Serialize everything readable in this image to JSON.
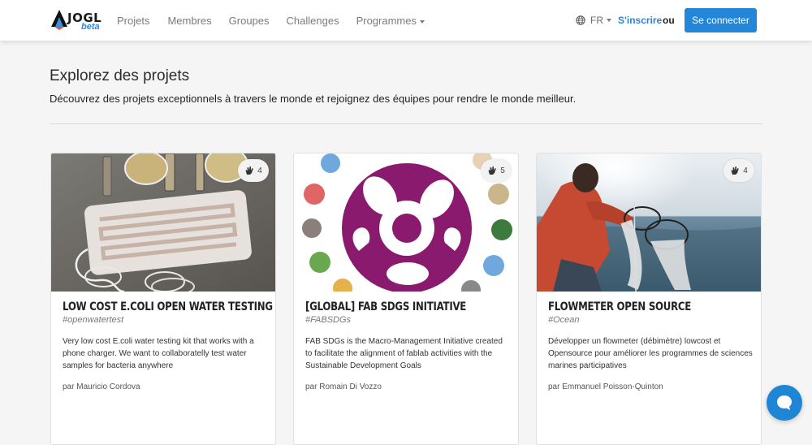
{
  "navbar": {
    "logo_text": "JOGL",
    "logo_beta": "beta",
    "links": [
      "Projets",
      "Membres",
      "Groupes",
      "Challenges",
      "Programmes"
    ],
    "language": "FR",
    "signup": "S'inscrire",
    "or": "ou",
    "login": "Se connecter"
  },
  "header": {
    "title": "Explorez des projets",
    "subtitle": "Découvrez des projets exceptionnels à travers le monde et rejoignez des équipes pour rendre le monde meilleur."
  },
  "cards": [
    {
      "title": "Low cost E.coli open water testing kit",
      "tag": "#openwatertest",
      "description": "Very low cost E.coli water testing kit that works with a phone charger. We want to collaboratelly test water samples for bacteria anywhere",
      "author_prefix": "par",
      "author": "Mauricio Cordova",
      "claps": "4"
    },
    {
      "title": "[GLOBAL] FAB SDGS INITIATIVE",
      "tag": "#FABSDGs",
      "description": "FAB SDGs is the Macro-Management Initiative created to facilitate the alignment of fablab activities with the Sustainable Development Goals",
      "author_prefix": "par",
      "author": "Romain Di Vozzo",
      "claps": "5"
    },
    {
      "title": "FLOWMETER OPEN SOURCE",
      "tag": "#Ocean",
      "description": "Développer un flowmeter (débimètre) lowcost et Opensource pour améliorer les programmes de sciences marines participatives",
      "author_prefix": "par",
      "author": "Emmanuel Poisson-Quinton",
      "claps": "4"
    }
  ],
  "colors": {
    "primary": "#2486d9",
    "link": "#2a85d6",
    "fab_purple": "#8a1a6e"
  }
}
